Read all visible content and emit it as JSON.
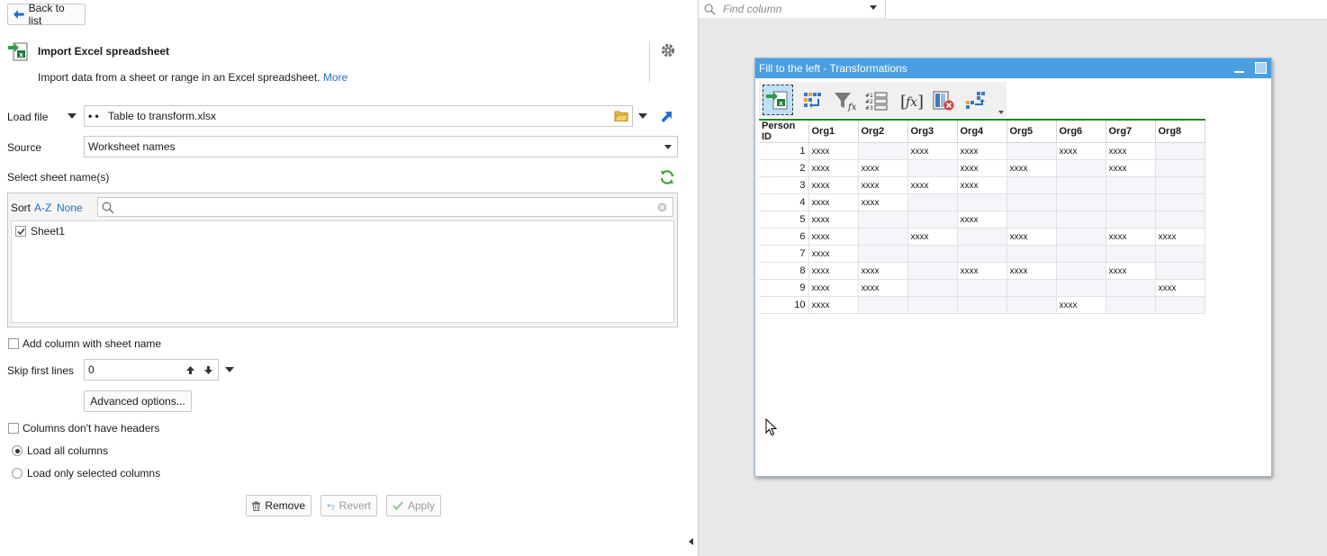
{
  "left": {
    "back_label": "Back to list",
    "step": {
      "title": "Import Excel spreadsheet",
      "description": "Import data from a sheet or range in an Excel spreadsheet.",
      "more_link": "More"
    },
    "load_file": {
      "label": "Load file",
      "prefix": "• •",
      "value": "Table to transform.xlsx"
    },
    "source": {
      "label": "Source",
      "value": "Worksheet names"
    },
    "sheet_section": {
      "label": "Select sheet name(s)",
      "sort_label": "Sort",
      "sort_az": "A-Z",
      "sort_none": "None",
      "search_placeholder": "",
      "items": [
        {
          "label": "Sheet1",
          "checked": true
        }
      ]
    },
    "add_column_label": "Add column with sheet name",
    "skip": {
      "label": "Skip first lines",
      "value": "0"
    },
    "advanced_label": "Advanced options...",
    "no_headers_label": "Columns don't have headers",
    "load_all_label": "Load all columns",
    "load_selected_label": "Load only selected columns",
    "buttons": {
      "remove": "Remove",
      "revert": "Revert",
      "apply": "Apply"
    }
  },
  "right": {
    "find_placeholder": "Find column",
    "window_title": "Fill to the left - Transformations",
    "columns": [
      "Person ID",
      "Org1",
      "Org2",
      "Org3",
      "Org4",
      "Org5",
      "Org6",
      "Org7",
      "Org8"
    ],
    "rows": [
      [
        "1",
        "xxxx",
        "",
        "xxxx",
        "xxxx",
        "",
        "xxxx",
        "xxxx",
        ""
      ],
      [
        "2",
        "xxxx",
        "xxxx",
        "",
        "xxxx",
        "xxxx",
        "",
        "xxxx",
        ""
      ],
      [
        "3",
        "xxxx",
        "xxxx",
        "xxxx",
        "xxxx",
        "",
        "",
        "",
        ""
      ],
      [
        "4",
        "xxxx",
        "xxxx",
        "",
        "",
        "",
        "",
        "",
        ""
      ],
      [
        "5",
        "xxxx",
        "",
        "",
        "xxxx",
        "",
        "",
        "",
        ""
      ],
      [
        "6",
        "xxxx",
        "",
        "xxxx",
        "",
        "xxxx",
        "",
        "xxxx",
        "xxxx"
      ],
      [
        "7",
        "xxxx",
        "",
        "",
        "",
        "",
        "",
        "",
        ""
      ],
      [
        "8",
        "xxxx",
        "xxxx",
        "",
        "xxxx",
        "xxxx",
        "",
        "xxxx",
        ""
      ],
      [
        "9",
        "xxxx",
        "xxxx",
        "",
        "",
        "",
        "",
        "",
        "xxxx"
      ],
      [
        "10",
        "xxxx",
        "",
        "",
        "",
        "",
        "xxxx",
        "",
        ""
      ]
    ]
  },
  "colors": {
    "accent_blue": "#1f6fc5",
    "title_bar": "#4a9fe0",
    "refresh_green": "#3aa33a",
    "header_rule": "#1d8a1d"
  }
}
